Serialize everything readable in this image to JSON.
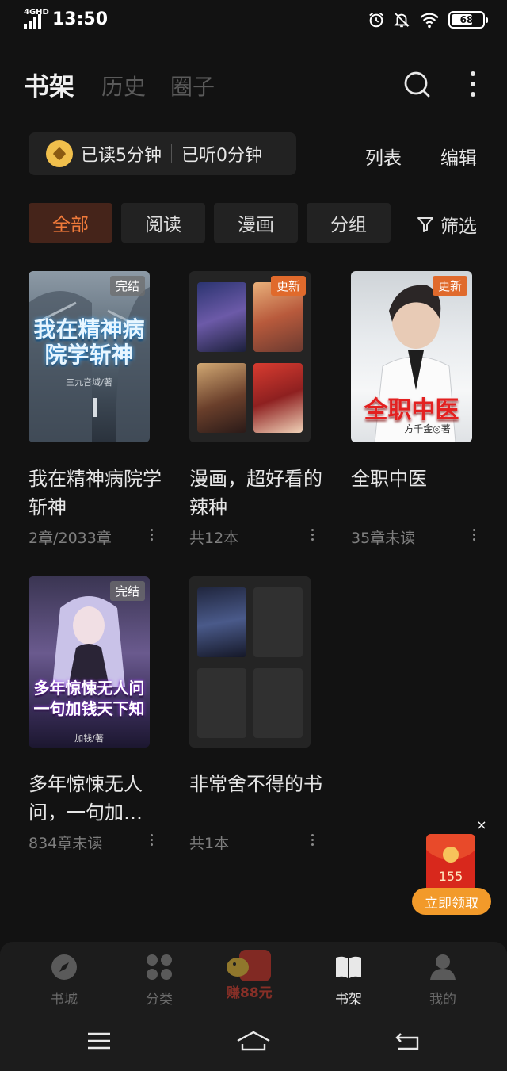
{
  "status_bar": {
    "network": "4GHD",
    "time": "13:50",
    "battery": "68",
    "battery_level": 0.68
  },
  "header": {
    "tabs": [
      {
        "label": "书架",
        "active": true
      },
      {
        "label": "历史",
        "active": false
      },
      {
        "label": "圈子",
        "active": false
      }
    ],
    "search_icon": "search-icon",
    "more_icon": "more-vertical-icon"
  },
  "stats": {
    "read_time": "已读5分钟",
    "listen_time": "已听0分钟",
    "list_label": "列表",
    "edit_label": "编辑"
  },
  "filters": {
    "chips": [
      "全部",
      "阅读",
      "漫画",
      "分组"
    ],
    "active_index": 0,
    "filter_label": "筛选"
  },
  "books": [
    {
      "title": "我在精神病院学斩神",
      "meta": "2章/2033章",
      "badge": "完结",
      "cover_text": "我在精神病院学斩神",
      "cover_author": "三九音域/著"
    },
    {
      "title": "漫画，超好看的辣种",
      "meta": "共12本",
      "badge": "更新",
      "group": true
    },
    {
      "title": "全职中医",
      "meta": "35章未读",
      "badge": "更新",
      "cover_text": "全职中医",
      "cover_author": "方千金◎著"
    },
    {
      "title": "多年惊悚无人问，一句加…",
      "meta": "834章未读",
      "badge": "完结",
      "cover_text": "多年惊悚无人问 一句加钱天下知",
      "cover_author": "加钱/著"
    },
    {
      "title": "非常舍不得的书",
      "meta": "共1本",
      "group": true
    }
  ],
  "red_packet": {
    "amount": "155",
    "button": "立即领取",
    "close": "×"
  },
  "bottom_nav": [
    {
      "label": "书城",
      "icon": "compass-icon",
      "active": false
    },
    {
      "label": "分类",
      "icon": "category-icon",
      "active": false
    },
    {
      "promo": "赚88元",
      "icon": "promo-icon"
    },
    {
      "label": "书架",
      "icon": "book-icon",
      "active": true
    },
    {
      "label": "我的",
      "icon": "user-icon",
      "active": false
    }
  ],
  "system_nav": [
    "menu-icon",
    "home-icon",
    "back-icon"
  ],
  "colors": {
    "background": "#121212",
    "accent": "#f07a3a",
    "update_badge": "#e06a2c",
    "coin": "#f0bf4c"
  }
}
